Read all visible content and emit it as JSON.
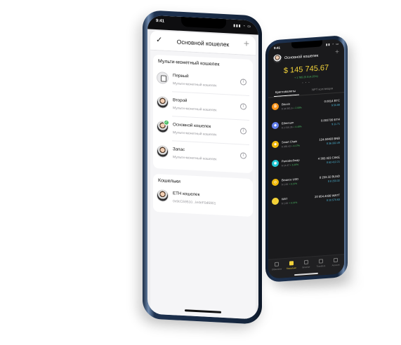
{
  "phone_light": {
    "status_time": "9:41",
    "status_icons": "▮▮▮ ◔ ▭",
    "header": {
      "done_icon": "check-icon",
      "title": "Основной кошелек",
      "add_icon": "plus-icon"
    },
    "multi_section": {
      "title": "Мульти-монетный кошелек",
      "wallets": [
        {
          "name": "Первый",
          "subtitle": "Мульти-монетный кошелек",
          "avatar": "document-icon"
        },
        {
          "name": "Второй",
          "subtitle": "Мульти-монетный кошелек",
          "avatar": "person-avatar"
        },
        {
          "name": "Основной кошелек",
          "subtitle": "Мульти-монетный кошелек",
          "avatar": "person-avatar",
          "active": true
        },
        {
          "name": "Запас",
          "subtitle": "Мульти-монетный кошелек",
          "avatar": "person-avatar"
        }
      ]
    },
    "wallets_section": {
      "title": "Кошельки",
      "wallets": [
        {
          "name": "ETH кошелек",
          "subtitle": "0x9cC69510...le4eF0d6901",
          "avatar": "person-avatar"
        }
      ]
    },
    "info_symbol": "i"
  },
  "phone_dark": {
    "status_time": "9:41",
    "status_icons": "▮▮ ◔ ▭",
    "wallet_title": "Основной кошелек",
    "balance": "$ 145 745.67",
    "balance_change": "+ 1 765.25 $ (4.25%)",
    "page_dots": "• • •",
    "tabs": {
      "active": "Криптовалюты",
      "inactive": "NFT коллекция"
    },
    "assets": [
      {
        "name": "Bitcoin",
        "price": "$ 34 581.6",
        "change": "+ 2.68%",
        "amount": "0.0014 BTC",
        "usd": "$ 50.88",
        "color": "#f7931a",
        "symbol": "₿"
      },
      {
        "name": "Ethereum",
        "price": "$ 2 316.36",
        "change": "+ 4.48%",
        "amount": "0.002739 ETH",
        "usd": "$ 11.71",
        "color": "#627eea",
        "symbol": "◆"
      },
      {
        "name": "Smart Chain",
        "price": "$ 355.43",
        "change": "+ 4.17%",
        "amount": "124.50483 BNB",
        "usd": "$ 36 332.49",
        "color": "#f0b90b",
        "symbol": "◈"
      },
      {
        "name": "PancakeSwap",
        "price": "$ 14.47",
        "change": "+ 5.16%",
        "amount": "4 382.323 CAKE",
        "usd": "$ 63 412.21",
        "color": "#1fc7d4",
        "symbol": "◉"
      },
      {
        "name": "Binance USD",
        "price": "$ 1.00",
        "change": "+ 0.11%",
        "amount": "8 253.32 BUSD",
        "usd": "$ 8 253.32",
        "color": "#f0b90b",
        "symbol": "◇"
      },
      {
        "name": "WAT",
        "price": "$ 1.00",
        "change": "+ 0.31%",
        "amount": "20 954.4038 WATT",
        "usd": "$ 20 570.63",
        "color": "#f2d23a",
        "symbol": "⚡"
      }
    ],
    "nav": [
      {
        "label": "Обменник",
        "active": false
      },
      {
        "label": "Кошельки",
        "active": true
      },
      {
        "label": "Browser",
        "active": false
      },
      {
        "label": "Transfers",
        "active": false
      },
      {
        "label": "Account",
        "active": false
      }
    ]
  }
}
